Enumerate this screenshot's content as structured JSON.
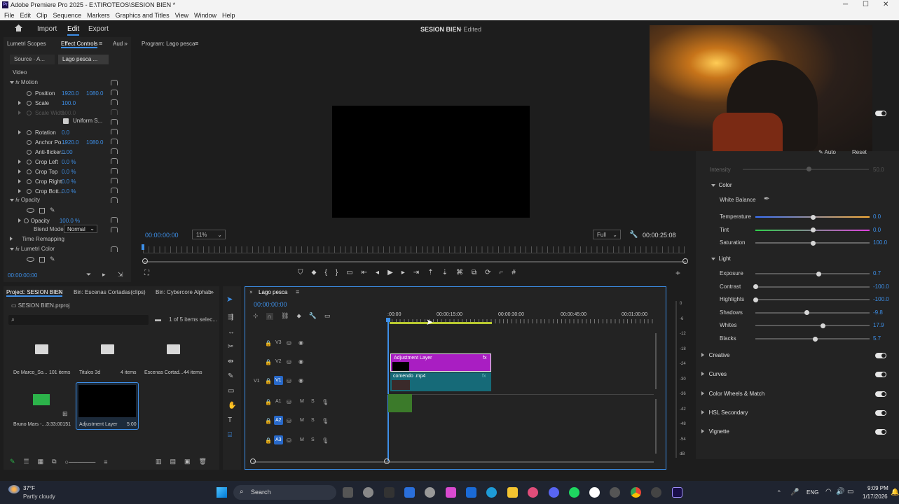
{
  "window": {
    "title": "Adobe Premiere Pro 2025 - E:\\TIROTEOS\\SESION BIEN *",
    "minimize": "─",
    "maximize": "☐",
    "close": "✕"
  },
  "menu": [
    "File",
    "Edit",
    "Clip",
    "Sequence",
    "Markers",
    "Graphics and Titles",
    "View",
    "Window",
    "Help"
  ],
  "workspace": {
    "tabs": [
      "Import",
      "Edit",
      "Export"
    ],
    "active": "Edit",
    "project_title": "SESION BIEN",
    "project_status": "- Edited"
  },
  "effect_controls": {
    "tabs": [
      "Lumetri Scopes",
      "Effect Controls",
      "Aud"
    ],
    "source": "Source · A...",
    "clip": "Lago pesca ...",
    "section": "Video",
    "motion": "Motion",
    "props": [
      {
        "name": "Position",
        "v1": "1920.0",
        "v2": "1080.0"
      },
      {
        "name": "Scale",
        "v1": "100.0",
        "v2": ""
      },
      {
        "name": "Scale Width",
        "v1": "100.0",
        "v2": ""
      },
      {
        "name": "Uniform S...",
        "v1": "",
        "v2": ""
      },
      {
        "name": "Rotation",
        "v1": "0.0",
        "v2": ""
      },
      {
        "name": "Anchor Po...",
        "v1": "1920.0",
        "v2": "1080.0"
      },
      {
        "name": "Anti-flicker...",
        "v1": "0.00",
        "v2": ""
      },
      {
        "name": "Crop Left",
        "v1": "0.0 %",
        "v2": ""
      },
      {
        "name": "Crop Top",
        "v1": "0.0 %",
        "v2": ""
      },
      {
        "name": "Crop Right",
        "v1": "0.0 %",
        "v2": ""
      },
      {
        "name": "Crop Bott...",
        "v1": "0.0 %",
        "v2": ""
      }
    ],
    "opacity_header": "Opacity",
    "opacity": {
      "name": "Opacity",
      "v1": "100.0 %"
    },
    "blend_label": "Blend Mode",
    "blend_value": "Normal",
    "time_remap": "Time Remapping",
    "lumetri": "Lumetri Color",
    "timecode": "00:00:00:00"
  },
  "program": {
    "title": "Program: Lago pesca",
    "timecode": "00:00:00:00",
    "zoom": "11%",
    "quality": "Full",
    "duration": "00:00:25:08"
  },
  "lumetri_panel": {
    "auto": "Auto",
    "reset": "Reset",
    "intensity": "Intensity",
    "intensity_val": "50.0",
    "color": "Color",
    "white_balance": "White Balance",
    "sliders_color": [
      {
        "name": "Temperature",
        "value": "0.0",
        "pos": 0.5
      },
      {
        "name": "Tint",
        "value": "0.0",
        "pos": 0.5
      },
      {
        "name": "Saturation",
        "value": "100.0",
        "pos": 0.5
      }
    ],
    "light": "Light",
    "sliders_light": [
      {
        "name": "Exposure",
        "value": "0.7",
        "pos": 0.55
      },
      {
        "name": "Contrast",
        "value": "-100.0",
        "pos": 0.0
      },
      {
        "name": "Highlights",
        "value": "-100.0",
        "pos": 0.0
      },
      {
        "name": "Shadows",
        "value": "-9.8",
        "pos": 0.45
      },
      {
        "name": "Whites",
        "value": "17.9",
        "pos": 0.59
      },
      {
        "name": "Blacks",
        "value": "5.7",
        "pos": 0.52
      }
    ],
    "sections": [
      "Creative",
      "Curves",
      "Color Wheels & Match",
      "HSL Secondary",
      "Vignette"
    ]
  },
  "project": {
    "tabs": [
      "Project: SESION BIEN",
      "Bin: Escenas Cortadas(clips)",
      "Bin: Cybercore Alphab"
    ],
    "file": "SESION BIEN.prproj",
    "selection": "1 of 5 items selec...",
    "items": [
      {
        "name": "De Marco_So...",
        "meta": "101 items"
      },
      {
        "name": "Titulos 3d",
        "meta": "4 items"
      },
      {
        "name": "Escenas Cortad...",
        "meta": "44 items"
      },
      {
        "name": "Bruno Mars -...",
        "meta": "3:33:00151"
      },
      {
        "name": "Adjustment Layer",
        "meta": "5:00"
      }
    ]
  },
  "timeline": {
    "title": "Lago pesca",
    "timecode": "00:00:00:00",
    "ruler": [
      ":00:00",
      "00:00:15:00",
      "00:00:30:00",
      "00:00:45:00",
      "00:01:00:00"
    ],
    "tracks": [
      "V3",
      "V2",
      "V1",
      "A1",
      "A2",
      "A3"
    ],
    "clip_adjust": "Adjustment Layer",
    "clip_video": "comendo .mp4",
    "meter": [
      "0",
      "-6",
      "-12",
      "-18",
      "-24",
      "-30",
      "-36",
      "-42",
      "-48",
      "-54",
      "dB"
    ]
  },
  "taskbar": {
    "temp": "37°F",
    "weather": "Partly cloudy",
    "search": "Search",
    "lang": "ENG",
    "time": "9:09 PM",
    "date": "1/17/2026"
  }
}
